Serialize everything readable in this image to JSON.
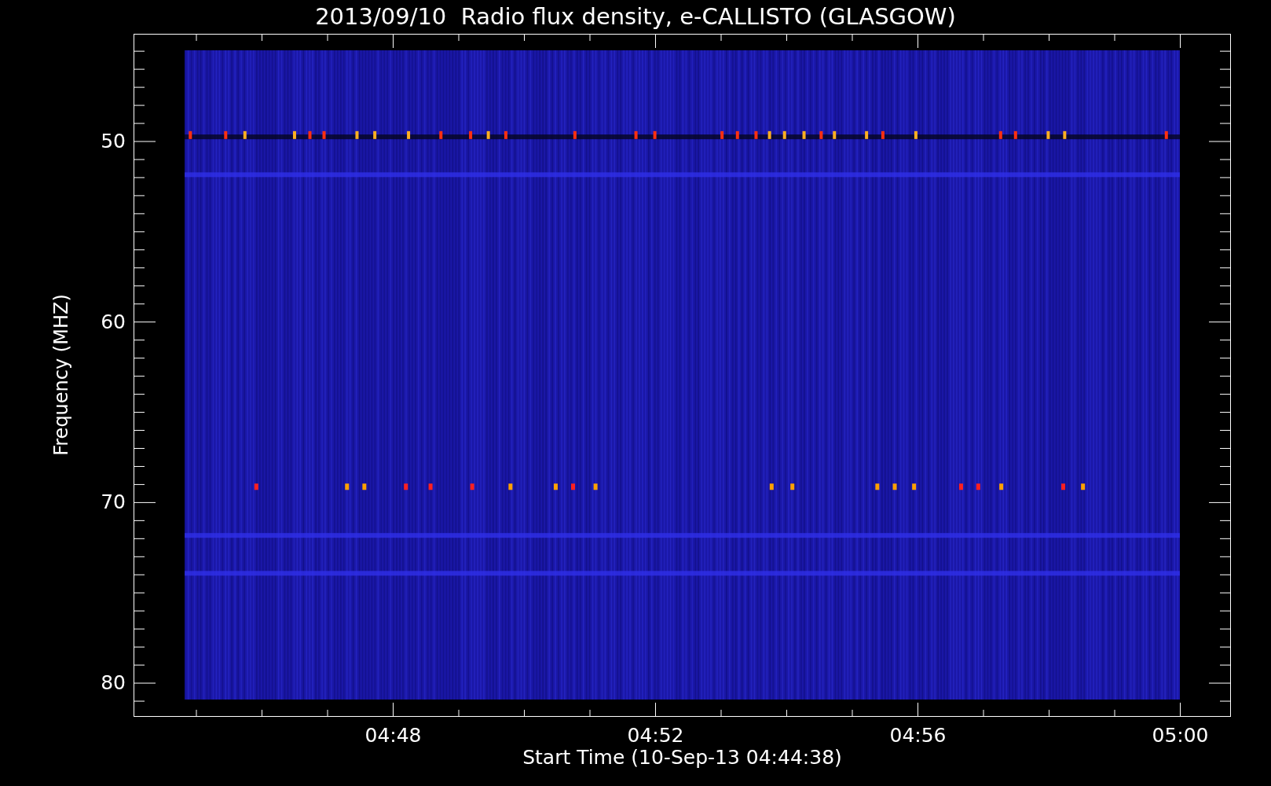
{
  "chart": {
    "title": "2013/09/10  Radio flux density, e-CALLISTO (GLASGOW)",
    "ylabel": "Frequency (MHZ)",
    "xlabel": "Start Time (10-Sep-13 04:44:38)",
    "yticks": [
      "50",
      "60",
      "70",
      "80"
    ],
    "xticks": [
      "04:48",
      "04:52",
      "04:56",
      "05:00"
    ]
  }
}
